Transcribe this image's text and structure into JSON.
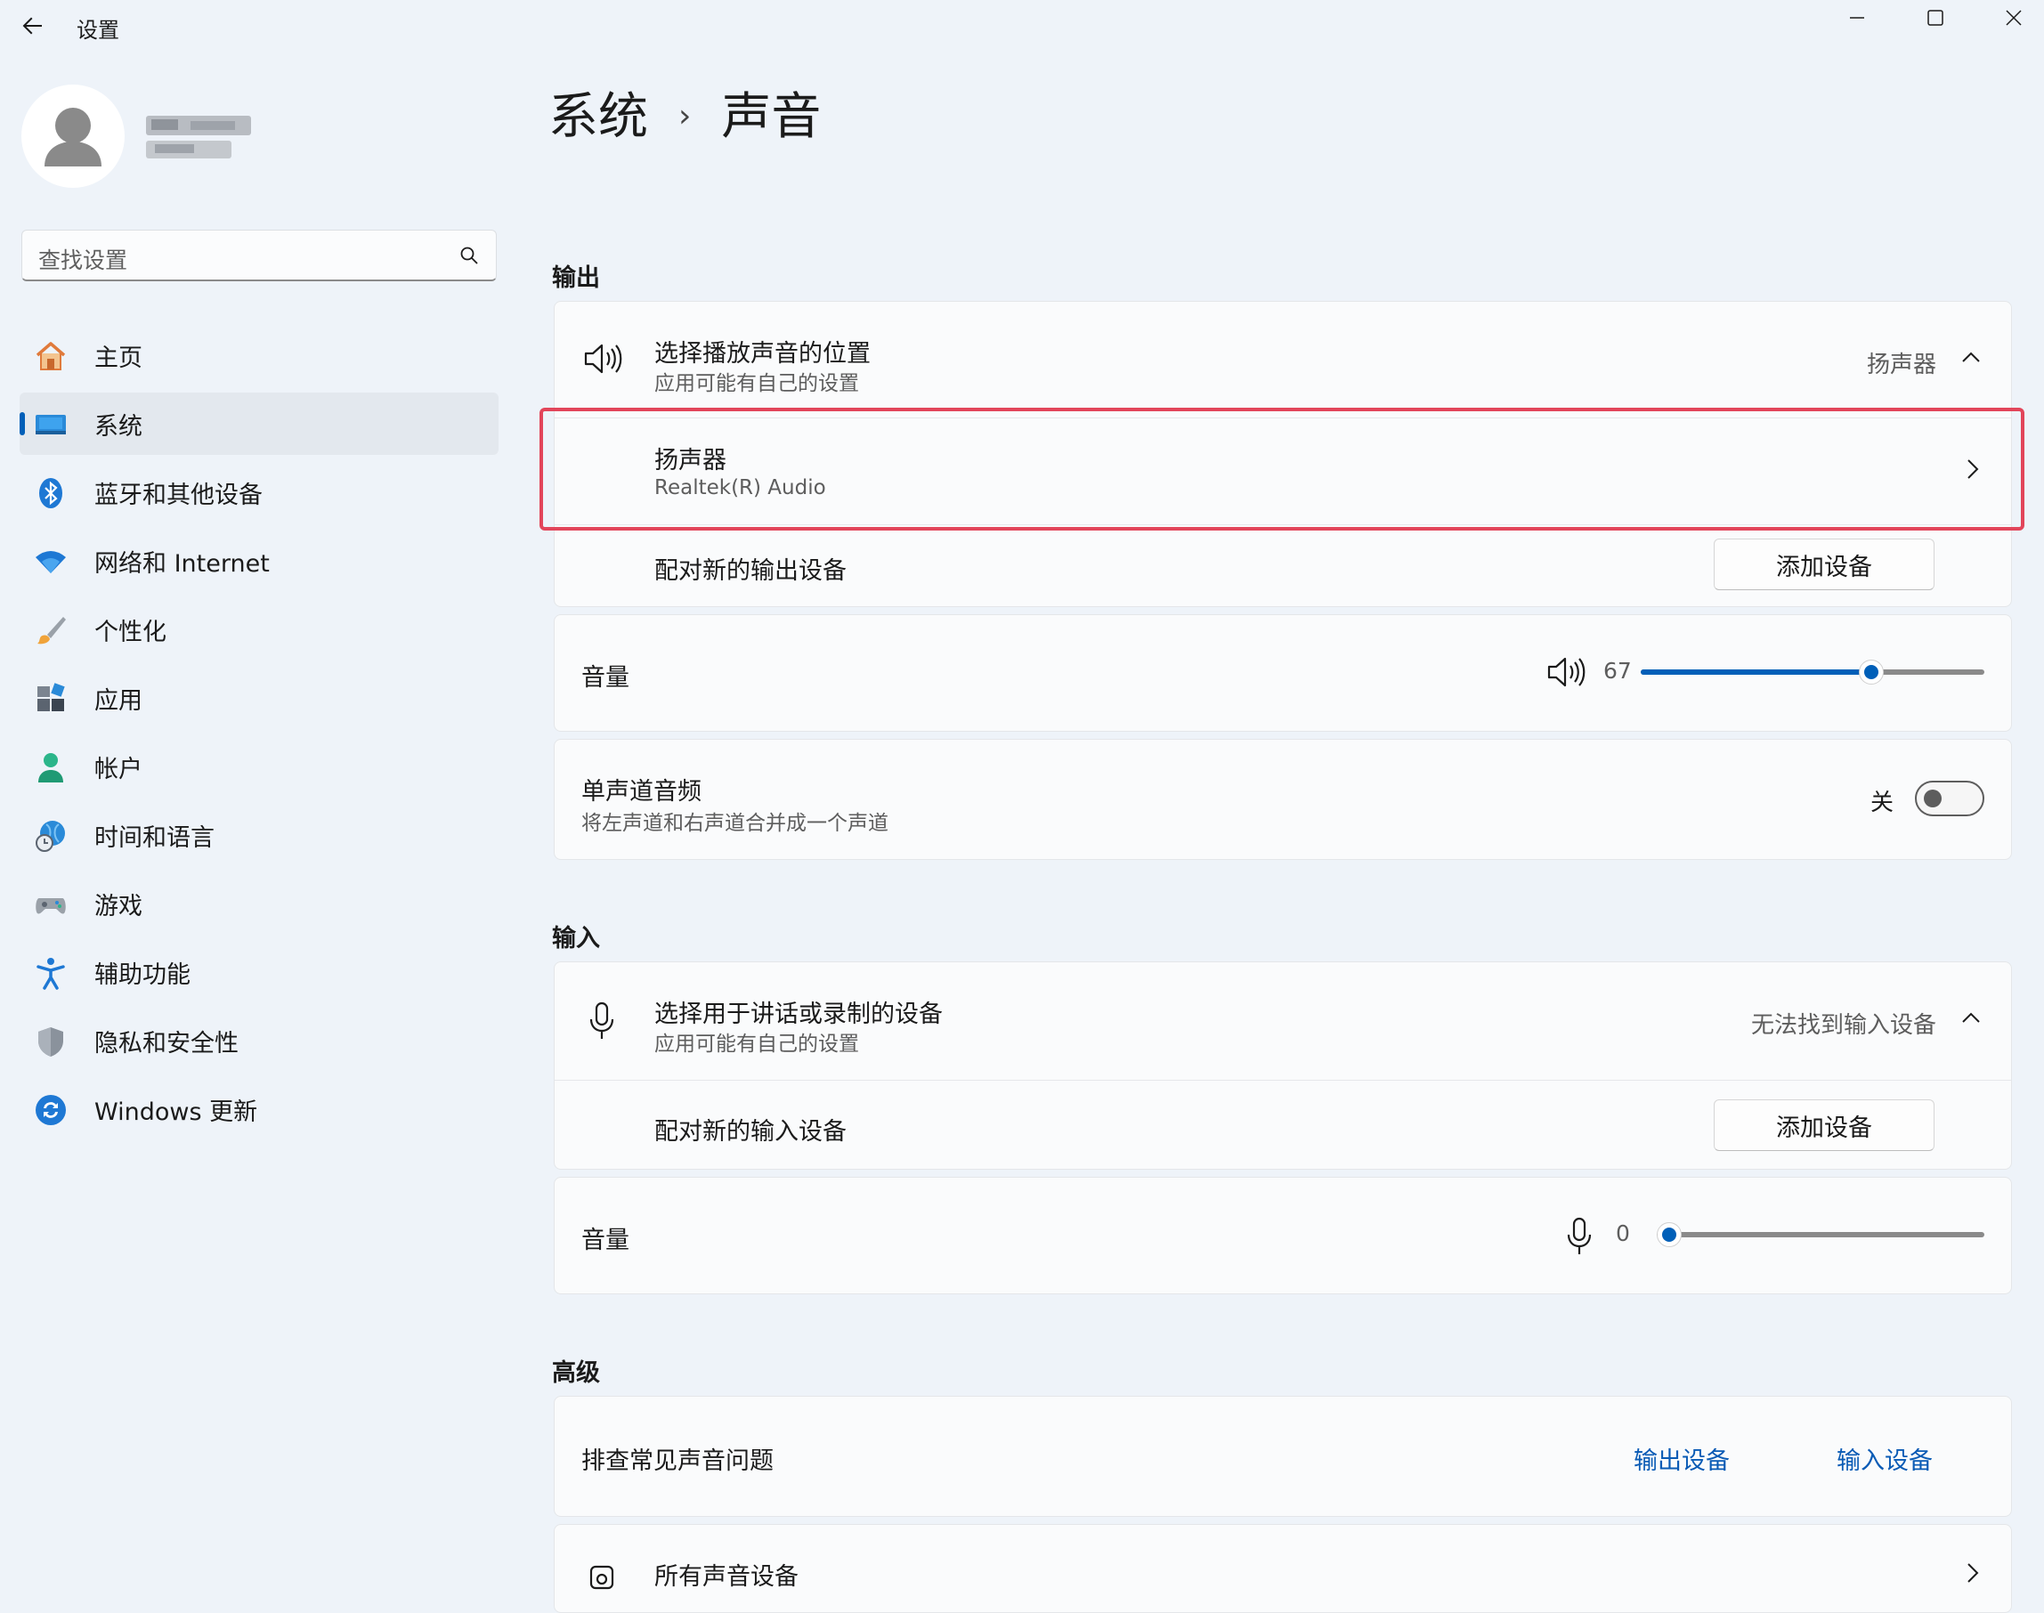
{
  "window": {
    "title": "设置"
  },
  "user": {
    "name": "",
    "email": ""
  },
  "search": {
    "placeholder": "查找设置"
  },
  "sidebar": {
    "items": [
      {
        "label": "主页",
        "icon": "home-icon"
      },
      {
        "label": "系统",
        "icon": "system-icon",
        "active": true
      },
      {
        "label": "蓝牙和其他设备",
        "icon": "bluetooth-icon"
      },
      {
        "label": "网络和 Internet",
        "icon": "wifi-icon"
      },
      {
        "label": "个性化",
        "icon": "brush-icon"
      },
      {
        "label": "应用",
        "icon": "apps-icon"
      },
      {
        "label": "帐户",
        "icon": "account-icon"
      },
      {
        "label": "时间和语言",
        "icon": "globe-clock-icon"
      },
      {
        "label": "游戏",
        "icon": "gamepad-icon"
      },
      {
        "label": "辅助功能",
        "icon": "accessibility-icon"
      },
      {
        "label": "隐私和安全性",
        "icon": "shield-icon"
      },
      {
        "label": "Windows 更新",
        "icon": "update-icon"
      }
    ]
  },
  "breadcrumb": {
    "parent": "系统",
    "separator": "›",
    "current": "声音"
  },
  "output": {
    "heading": "输出",
    "choose_title": "选择播放声音的位置",
    "choose_sub": "应用可能有自己的设置",
    "choose_value": "扬声器",
    "device_name": "扬声器",
    "device_sub": "Realtek(R) Audio",
    "pair_label": "配对新的输出设备",
    "add_button": "添加设备",
    "volume_label": "音量",
    "volume_value": "67",
    "volume_fraction": 0.67,
    "mono_title": "单声道音频",
    "mono_sub": "将左声道和右声道合并成一个声道",
    "mono_state": "关"
  },
  "input": {
    "heading": "输入",
    "choose_title": "选择用于讲话或录制的设备",
    "choose_sub": "应用可能有自己的设置",
    "choose_value": "无法找到输入设备",
    "pair_label": "配对新的输入设备",
    "add_button": "添加设备",
    "volume_label": "音量",
    "volume_value": "0",
    "volume_fraction": 0
  },
  "advanced": {
    "heading": "高级",
    "troubleshoot_label": "排查常见声音问题",
    "output_link": "输出设备",
    "input_link": "输入设备",
    "all_devices": "所有声音设备"
  },
  "colors": {
    "accent": "#005fb8",
    "highlight": "#e2455a",
    "background": "#eef3f9"
  }
}
